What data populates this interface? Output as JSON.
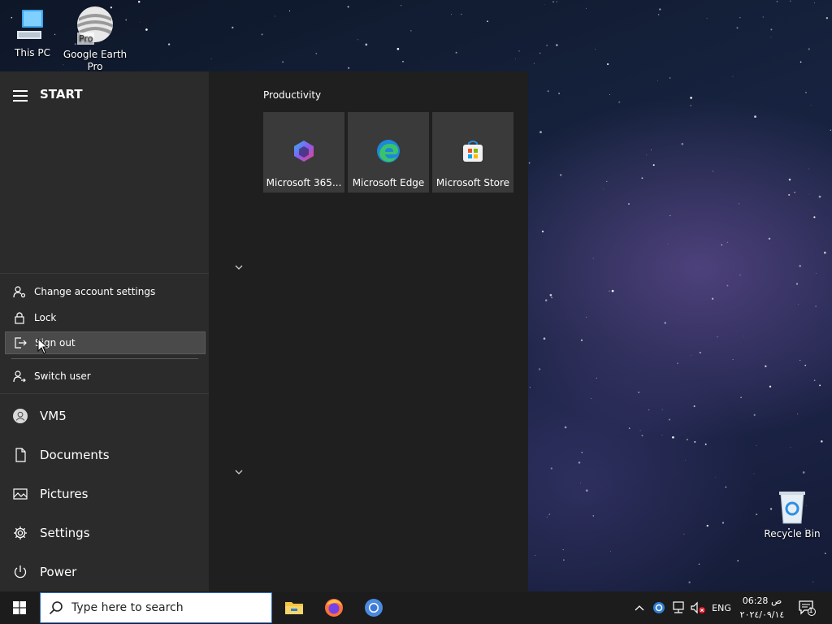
{
  "desktop": {
    "icons": [
      {
        "label": "This PC"
      },
      {
        "label": "Google Earth Pro",
        "badge": "Pro"
      },
      {
        "label": "Recycle Bin"
      }
    ]
  },
  "start_menu": {
    "title": "START",
    "account_menu": {
      "items": [
        {
          "label": "Change account settings",
          "icon": "person-gear-icon"
        },
        {
          "label": "Lock",
          "icon": "lock-icon"
        },
        {
          "label": "Sign out",
          "icon": "sign-out-icon",
          "highlighted": true
        },
        {
          "label": "Switch user",
          "icon": "switch-user-icon"
        }
      ]
    },
    "nav": [
      {
        "label": "VM5",
        "icon": "user-avatar-icon"
      },
      {
        "label": "Documents",
        "icon": "document-icon"
      },
      {
        "label": "Pictures",
        "icon": "pictures-icon"
      },
      {
        "label": "Settings",
        "icon": "gear-icon"
      },
      {
        "label": "Power",
        "icon": "power-icon"
      }
    ],
    "group": {
      "title": "Productivity",
      "tiles": [
        {
          "label": "Microsoft 365...",
          "icon": "microsoft-365-icon"
        },
        {
          "label": "Microsoft Edge",
          "icon": "edge-icon"
        },
        {
          "label": "Microsoft Store",
          "icon": "store-icon"
        }
      ]
    }
  },
  "taskbar": {
    "search_placeholder": "Type here to search",
    "pinned": [
      "file-explorer-icon",
      "firefox-icon",
      "chrome-icon"
    ],
    "tray": {
      "language": "ENG",
      "time": "06:28 ص",
      "date": "٢٠٢٤/٠٩/١٤",
      "notification_count": "1"
    }
  },
  "colors": {
    "taskbar": "#1c1c1c",
    "start_bg": "#1f1f1f",
    "nav_bg": "#2b2b2b",
    "tile_bg": "#3a3a3a",
    "accent": "#2d6fc4"
  }
}
